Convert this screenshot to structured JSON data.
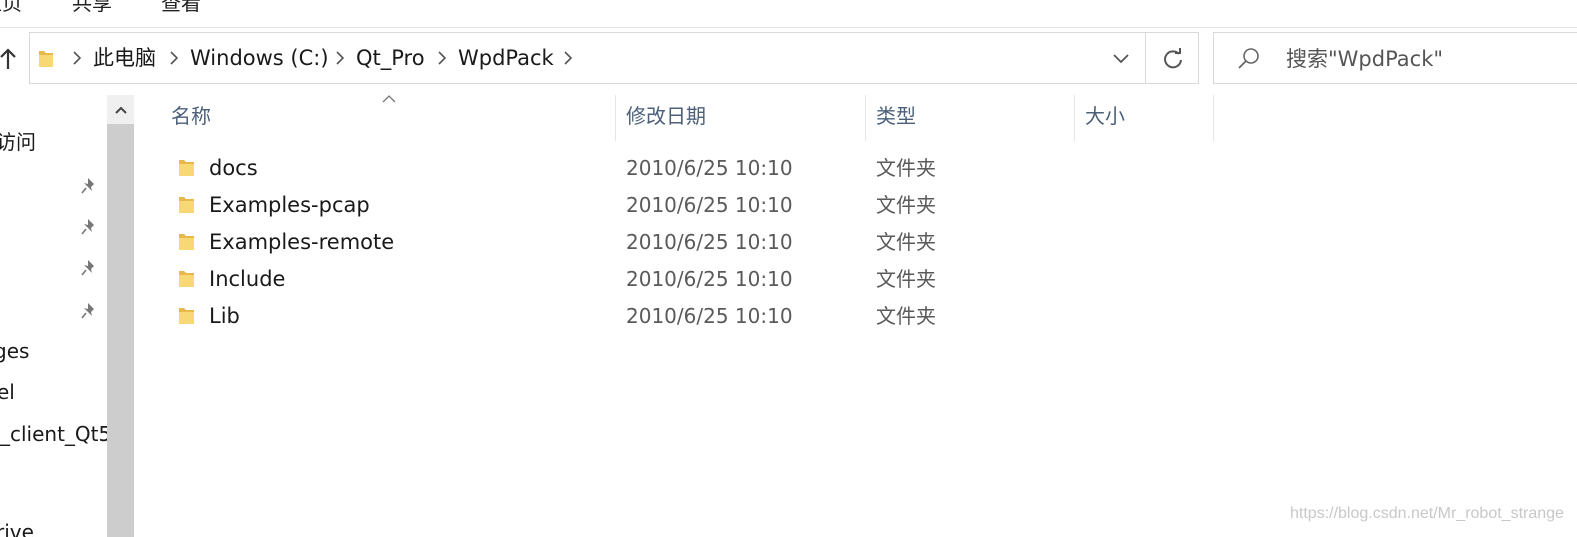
{
  "ribbon": {
    "tabs": [
      "主页",
      "共享",
      "查看"
    ]
  },
  "address": {
    "crumbs": [
      "此电脑",
      "Windows (C:)",
      "Qt_Pro",
      "WpdPack"
    ]
  },
  "search": {
    "placeholder": "搜索\"WpdPack\""
  },
  "icons": {
    "refresh": "refresh-icon",
    "search": "search-icon",
    "folder": "folder-icon",
    "pin": "pin-icon"
  },
  "nav": {
    "items": [
      "访问",
      "ges",
      "el",
      "_client_Qt5",
      "rive"
    ]
  },
  "columns": {
    "name": "名称",
    "modified": "修改日期",
    "type": "类型",
    "size": "大小"
  },
  "files": [
    {
      "name": "docs",
      "modified": "2010/6/25 10:10",
      "type": "文件夹"
    },
    {
      "name": "Examples-pcap",
      "modified": "2010/6/25 10:10",
      "type": "文件夹"
    },
    {
      "name": "Examples-remote",
      "modified": "2010/6/25 10:10",
      "type": "文件夹"
    },
    {
      "name": "Include",
      "modified": "2010/6/25 10:10",
      "type": "文件夹"
    },
    {
      "name": "Lib",
      "modified": "2010/6/25 10:10",
      "type": "文件夹"
    }
  ],
  "watermark": "https://blog.csdn.net/Mr_robot_strange",
  "colors": {
    "header_text": "#4c607a",
    "folder_yellow": "#f8d775",
    "folder_dark": "#e8b84a"
  }
}
